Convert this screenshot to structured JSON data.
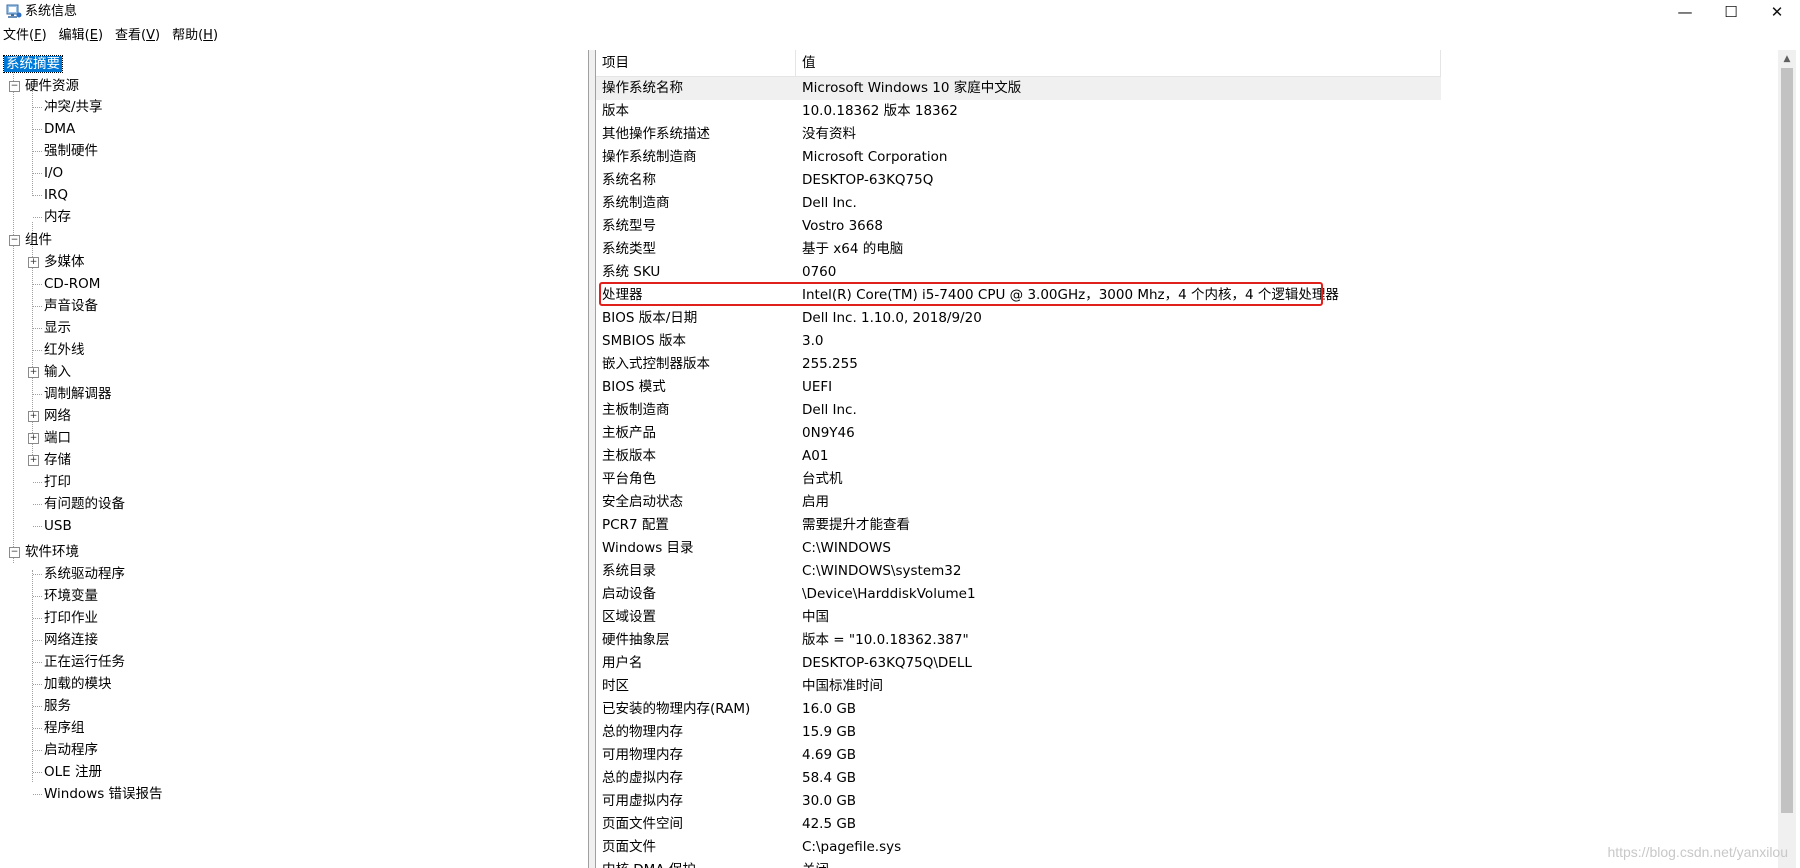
{
  "window": {
    "title": "系统信息",
    "minimize_glyph": "—",
    "maximize_glyph": "☐",
    "close_glyph": "✕"
  },
  "menu": [
    {
      "label": "文件(",
      "key": "F",
      "suffix": ")"
    },
    {
      "label": "编辑(",
      "key": "E",
      "suffix": ")"
    },
    {
      "label": "查看(",
      "key": "V",
      "suffix": ")"
    },
    {
      "label": "帮助(",
      "key": "H",
      "suffix": ")"
    }
  ],
  "tree": {
    "root": "系统摘要",
    "hardware": {
      "label": "硬件资源",
      "children": [
        "冲突/共享",
        "DMA",
        "强制硬件",
        "I/O",
        "IRQ",
        "内存"
      ]
    },
    "components": {
      "label": "组件",
      "children": [
        "多媒体",
        "CD-ROM",
        "声音设备",
        "显示",
        "红外线",
        "输入",
        "调制解调器",
        "网络",
        "端口",
        "存储",
        "打印",
        "有问题的设备",
        "USB"
      ]
    },
    "software": {
      "label": "软件环境",
      "children": [
        "系统驱动程序",
        "环境变量",
        "打印作业",
        "网络连接",
        "正在运行任务",
        "加载的模块",
        "服务",
        "程序组",
        "启动程序",
        "OLE 注册",
        "Windows 错误报告"
      ]
    }
  },
  "list": {
    "headers": {
      "item": "项目",
      "value": "值"
    },
    "rows": [
      {
        "k": "操作系统名称",
        "v": "Microsoft Windows 10 家庭中文版"
      },
      {
        "k": "版本",
        "v": "10.0.18362 版本 18362"
      },
      {
        "k": "其他操作系统描述",
        "v": "没有资料"
      },
      {
        "k": "操作系统制造商",
        "v": "Microsoft Corporation"
      },
      {
        "k": "系统名称",
        "v": "DESKTOP-63KQ75Q"
      },
      {
        "k": "系统制造商",
        "v": "Dell Inc."
      },
      {
        "k": "系统型号",
        "v": "Vostro 3668"
      },
      {
        "k": "系统类型",
        "v": "基于 x64 的电脑"
      },
      {
        "k": "系统 SKU",
        "v": "0760"
      },
      {
        "k": "处理器",
        "v": "Intel(R) Core(TM) i5-7400 CPU @ 3.00GHz，3000 Mhz，4 个内核，4 个逻辑处理器"
      },
      {
        "k": "BIOS 版本/日期",
        "v": "Dell Inc. 1.10.0, 2018/9/20"
      },
      {
        "k": "SMBIOS 版本",
        "v": "3.0"
      },
      {
        "k": "嵌入式控制器版本",
        "v": "255.255"
      },
      {
        "k": "BIOS 模式",
        "v": "UEFI"
      },
      {
        "k": "主板制造商",
        "v": "Dell Inc."
      },
      {
        "k": "主板产品",
        "v": "0N9Y46"
      },
      {
        "k": "主板版本",
        "v": "A01"
      },
      {
        "k": "平台角色",
        "v": "台式机"
      },
      {
        "k": "安全启动状态",
        "v": "启用"
      },
      {
        "k": "PCR7 配置",
        "v": "需要提升才能查看"
      },
      {
        "k": "Windows 目录",
        "v": "C:\\WINDOWS"
      },
      {
        "k": "系统目录",
        "v": "C:\\WINDOWS\\system32"
      },
      {
        "k": "启动设备",
        "v": "\\Device\\HarddiskVolume1"
      },
      {
        "k": "区域设置",
        "v": "中国"
      },
      {
        "k": "硬件抽象层",
        "v": "版本 = \"10.0.18362.387\""
      },
      {
        "k": "用户名",
        "v": "DESKTOP-63KQ75Q\\DELL"
      },
      {
        "k": "时区",
        "v": "中国标准时间"
      },
      {
        "k": "已安装的物理内存(RAM)",
        "v": "16.0 GB"
      },
      {
        "k": "总的物理内存",
        "v": "15.9 GB"
      },
      {
        "k": "可用物理内存",
        "v": "4.69 GB"
      },
      {
        "k": "总的虚拟内存",
        "v": "58.4 GB"
      },
      {
        "k": "可用虚拟内存",
        "v": "30.0 GB"
      },
      {
        "k": "页面文件空间",
        "v": "42.5 GB"
      },
      {
        "k": "页面文件",
        "v": "C:\\pagefile.sys"
      },
      {
        "k": "内核 DMA 保护",
        "v": "关闭"
      }
    ]
  },
  "watermark": "https://blog.csdn.net/yanxilou",
  "colors": {
    "selection": "#0078d7",
    "highlight_box": "#e0201b"
  }
}
